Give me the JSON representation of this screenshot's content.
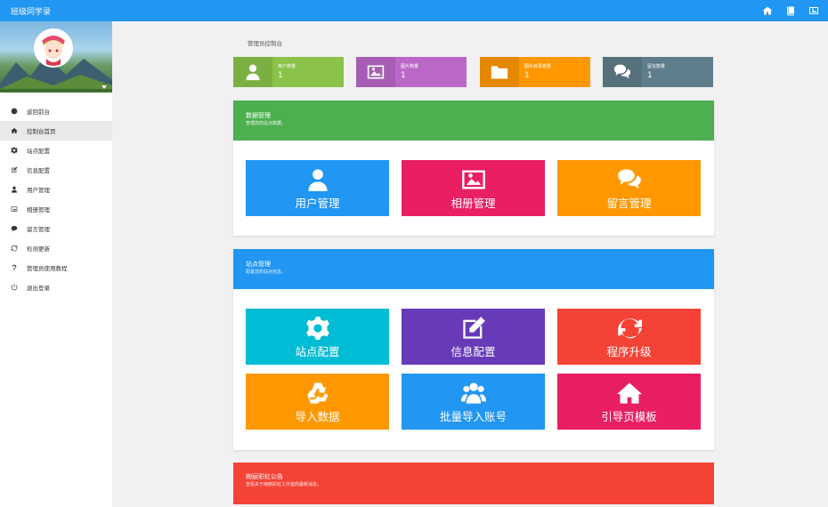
{
  "app": {
    "title": "班级同学录"
  },
  "header_icons": [
    "home-icon",
    "book-icon",
    "picture-icon"
  ],
  "sidebar": {
    "items": [
      {
        "label": "返回前台",
        "icon": "arrow-circle-left-icon"
      },
      {
        "label": "控制台首页",
        "icon": "home-icon",
        "active": true
      },
      {
        "label": "站点配置",
        "icon": "gear-icon"
      },
      {
        "label": "信息配置",
        "icon": "edit-icon"
      },
      {
        "label": "用户管理",
        "icon": "user-icon"
      },
      {
        "label": "相册管理",
        "icon": "picture-icon"
      },
      {
        "label": "留言管理",
        "icon": "comment-icon"
      },
      {
        "label": "检测更新",
        "icon": "refresh-icon"
      },
      {
        "label": "管理员使用教程",
        "icon": "question-icon"
      },
      {
        "label": "退出登录",
        "icon": "power-icon"
      }
    ]
  },
  "breadcrumb": "管理员控制台",
  "stats": [
    {
      "label": "用户数量",
      "value": "1",
      "color": "#8bc34a",
      "icon": "user-icon"
    },
    {
      "label": "图片数量",
      "value": "1",
      "color": "#ba68c8",
      "icon": "picture-icon"
    },
    {
      "label": "图片目录数量",
      "value": "1",
      "color": "#ff9800",
      "icon": "folder-icon"
    },
    {
      "label": "留言数量",
      "value": "1",
      "color": "#607d8b",
      "icon": "comments-icon"
    }
  ],
  "data_panel": {
    "title": "数据管理",
    "subtitle": "管理您的站点数据。",
    "color": "#4caf50",
    "tiles": [
      {
        "label": "用户管理",
        "color": "#2196f3",
        "icon": "user-icon"
      },
      {
        "label": "相册管理",
        "color": "#e91e63",
        "icon": "picture-icon"
      },
      {
        "label": "留言管理",
        "color": "#ff9800",
        "icon": "comments-icon"
      }
    ]
  },
  "site_panel": {
    "title": "站点管理",
    "subtitle": "配置您的站点信息。",
    "color": "#2196f3",
    "tiles": [
      {
        "label": "站点配置",
        "color": "#00bcd4",
        "icon": "gear-icon"
      },
      {
        "label": "信息配置",
        "color": "#673ab7",
        "icon": "edit-icon"
      },
      {
        "label": "程序升级",
        "color": "#f44336",
        "icon": "refresh-icon"
      },
      {
        "label": "导入数据",
        "color": "#ff9800",
        "icon": "recycle-icon"
      },
      {
        "label": "批量导入账号",
        "color": "#2196f3",
        "icon": "users-icon"
      },
      {
        "label": "引导页模板",
        "color": "#e91e63",
        "icon": "home-icon"
      }
    ]
  },
  "notice": {
    "title": "绚丽彩虹公告",
    "subtitle": "查看关于绚丽彩虹工作室的最新消息。",
    "color": "#f44336"
  }
}
